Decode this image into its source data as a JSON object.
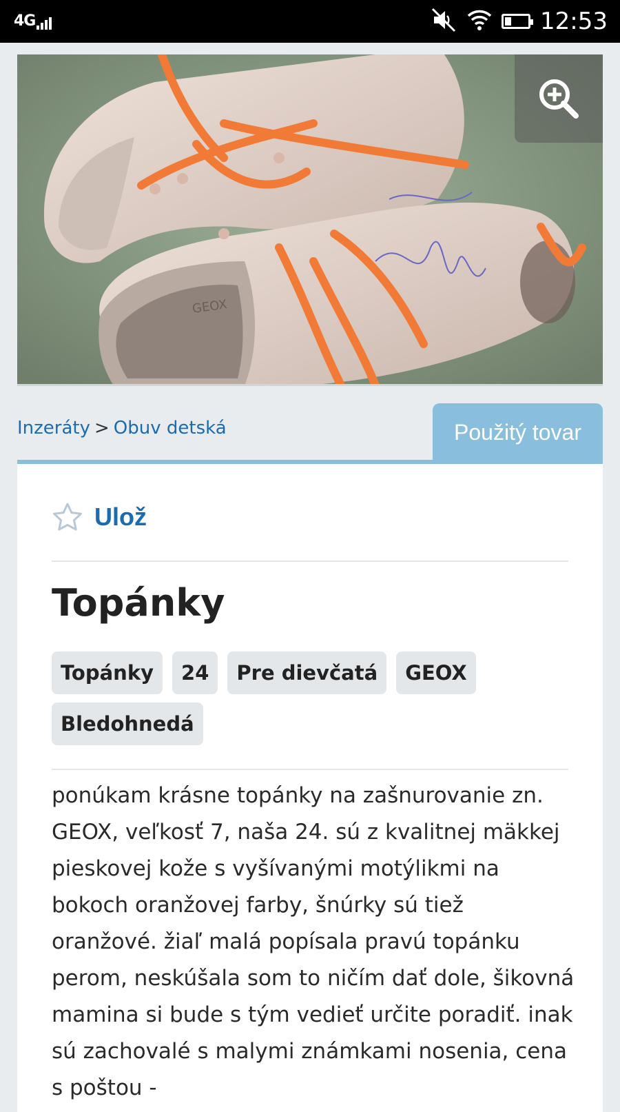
{
  "status_bar": {
    "network": "4G",
    "time": "12:53",
    "icons": [
      "signal-icon",
      "mute-icon",
      "wifi-icon",
      "battery-icon"
    ]
  },
  "photo": {
    "zoom_icon": "zoom-in-icon",
    "brand_on_insole": "GEOX"
  },
  "breadcrumb": {
    "items": [
      "Inzeráty",
      "Obuv detská"
    ],
    "separator": ">"
  },
  "condition": "Použitý tovar",
  "save": {
    "label": "Ulož",
    "icon": "star-outline-icon"
  },
  "listing": {
    "title": "Topánky",
    "tags": [
      "Topánky",
      "24",
      "Pre dievčatá",
      "GEOX",
      "Bledohnedá"
    ],
    "description": "ponúkam krásne topánky na zašnurovanie zn. GEOX, veľkosť 7, naša 24. sú z kvalitnej mäkkej pieskovej kože s vyšívanými motýlikmi na bokoch oranžovej farby, šnúrky sú tiež oranžové. žiaľ malá popísala pravú topánku perom, neskúšala som to ničím dať dole, šikovná mamina si bude s tým vedieť určite poradiť. inak sú zachovalé s malymi známkami nosenia, cena s poštou -"
  },
  "colors": {
    "link": "#1b6bb0",
    "accent": "#89bedc",
    "tag_bg": "#e4e7ea",
    "page_bg": "#e8ecef"
  }
}
